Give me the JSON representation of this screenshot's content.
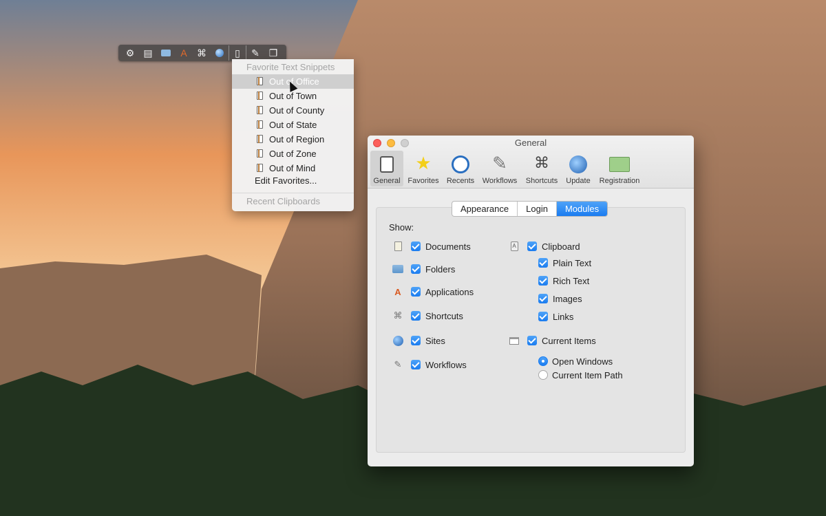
{
  "toolbar": {
    "icons": [
      "gear-icon",
      "document-icon",
      "folder-icon",
      "applications-icon",
      "command-icon",
      "globe-icon",
      "clipboard-icon",
      "wrench-icon",
      "windows-icon"
    ]
  },
  "menu": {
    "header_snippets": "Favorite Text Snippets",
    "items": [
      {
        "label": "Out of Office"
      },
      {
        "label": "Out of Town"
      },
      {
        "label": "Out of County"
      },
      {
        "label": "Out of State"
      },
      {
        "label": "Out of Region"
      },
      {
        "label": "Out of Zone"
      },
      {
        "label": "Out of Mind"
      }
    ],
    "edit_label": "Edit Favorites...",
    "header_clipboards": "Recent Clipboards"
  },
  "window": {
    "title": "General",
    "tabs": [
      {
        "label": "General",
        "icon": "general-icon"
      },
      {
        "label": "Favorites",
        "icon": "star-icon"
      },
      {
        "label": "Recents",
        "icon": "clock-icon"
      },
      {
        "label": "Workflows",
        "icon": "wrench-icon"
      },
      {
        "label": "Shortcuts",
        "icon": "command-icon"
      },
      {
        "label": "Update",
        "icon": "update-icon"
      },
      {
        "label": "Registration",
        "icon": "license-icon"
      }
    ],
    "segments": [
      "Appearance",
      "Login",
      "Modules"
    ],
    "selected_segment": "Modules",
    "show_label": "Show:",
    "left_options": [
      {
        "label": "Documents",
        "checked": true,
        "icon": "document-icon"
      },
      {
        "label": "Folders",
        "checked": true,
        "icon": "folder-icon"
      },
      {
        "label": "Applications",
        "checked": true,
        "icon": "applications-icon"
      },
      {
        "label": "Shortcuts",
        "checked": true,
        "icon": "command-icon"
      },
      {
        "label": "Sites",
        "checked": true,
        "icon": "globe-icon"
      },
      {
        "label": "Workflows",
        "checked": true,
        "icon": "wrench-icon"
      }
    ],
    "clipboard": {
      "label": "Clipboard",
      "checked": true,
      "sub": [
        {
          "label": "Plain Text",
          "checked": true
        },
        {
          "label": "Rich Text",
          "checked": true
        },
        {
          "label": "Images",
          "checked": true
        },
        {
          "label": "Links",
          "checked": true
        }
      ]
    },
    "current_items": {
      "label": "Current Items",
      "checked": true,
      "radios": [
        {
          "label": "Open Windows",
          "selected": true
        },
        {
          "label": "Current Item Path",
          "selected": false
        }
      ]
    }
  },
  "colors": {
    "accent": "#1a7cf0",
    "close": "#fc605c",
    "minimize": "#fdbc40"
  }
}
